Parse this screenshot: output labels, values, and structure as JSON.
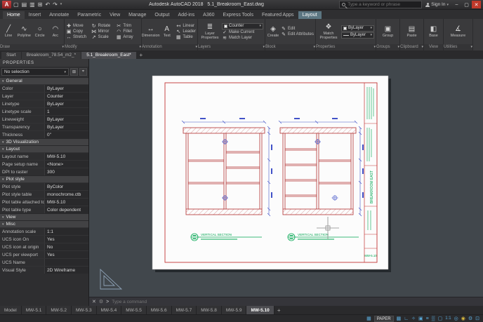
{
  "colors": {
    "accent_red": "#c23434",
    "dim_blue": "#4152c8",
    "anno_green": "#00a651",
    "status_blue": "#58a6d6"
  },
  "titlebar": {
    "logo": "A",
    "qat": {
      "new": "▢",
      "open": "▤",
      "save": "▥",
      "plot": "⊞",
      "undo": "↶",
      "redo": "↷",
      "dropdown": "▾"
    },
    "app_title": "Autodesk AutoCAD 2018",
    "doc_title": "5.1_Breakroom_East.dwg",
    "search_placeholder": "Type a keyword or phrase",
    "sign_in_label": "Sign In",
    "window": {
      "minimize": "–",
      "maximize": "▢",
      "close": "✕"
    }
  },
  "ribbon_tabs": [
    {
      "label": "Home",
      "active": true
    },
    {
      "label": "Insert"
    },
    {
      "label": "Annotate"
    },
    {
      "label": "Parametric"
    },
    {
      "label": "View"
    },
    {
      "label": "Manage"
    },
    {
      "label": "Output"
    },
    {
      "label": "Add-ins"
    },
    {
      "label": "A360"
    },
    {
      "label": "Express Tools"
    },
    {
      "label": "Featured Apps"
    },
    {
      "label": "Layout",
      "contextual": true
    }
  ],
  "ribbon": {
    "icons": {
      "caret": "▾",
      "line": "╱",
      "polyline": "∿",
      "circle": "○",
      "arc": "◠",
      "move": "✚",
      "copy": "▣",
      "stretch": "↔",
      "rotate": "↻",
      "mirror": "⋈",
      "scale": "↗",
      "trim": "✂",
      "fillet": "◠",
      "array": "▦",
      "dimension": "↔",
      "text": "A",
      "linear": "↤",
      "leader": "↖",
      "table": "▦",
      "layer_properties": "≣",
      "make_current": "✓",
      "match_layer": "≋",
      "create": "◈",
      "edit": "✎",
      "edit_attributes": "✎",
      "match_properties": "❖",
      "group": "▣",
      "paste": "▤",
      "base": "◧",
      "measure": "∡",
      "bylayer_line": "—"
    },
    "draw": {
      "label": "Draw",
      "line": "Line",
      "polyline": "Polyline",
      "circle": "Circle",
      "arc": "Arc"
    },
    "modify": {
      "label": "Modify",
      "move": "Move",
      "copy": "Copy",
      "stretch": "Stretch",
      "rotate": "Rotate",
      "mirror": "Mirror",
      "scale": "Scale",
      "trim": "Trim",
      "fillet": "Fillet",
      "array": "Array"
    },
    "annotation": {
      "label": "Annotation",
      "dimension": "Dimension",
      "text": "Text",
      "linear": "Linear",
      "leader": "Leader",
      "table": "Table"
    },
    "layers": {
      "label": "Layers",
      "layer_properties": "Layer Properties",
      "current_layer": "Counter",
      "make_current": "Make Current",
      "match_layer": "Match Layer"
    },
    "block": {
      "label": "Block",
      "create": "Create",
      "edit": "Edit",
      "edit_attributes": "Edit Attributes"
    },
    "properties": {
      "label": "Properties",
      "match_properties": "Match Properties",
      "bylayer_color": "ByLayer",
      "bylayer_lineweight": "ByLayer"
    },
    "groups": {
      "label": "Groups",
      "group": "Group"
    },
    "clipboard": {
      "label": "Clipboard",
      "paste": "Paste"
    },
    "view": {
      "label": "View",
      "base": "Base"
    },
    "utilities": {
      "label": "Utilities",
      "measure": "Measure"
    }
  },
  "file_tabs": [
    {
      "label": "Start"
    },
    {
      "label": "Breakroom_78.54_m2_*"
    },
    {
      "label": "5.1_Breakroom_East*",
      "active": true
    }
  ],
  "file_tab_add": "+",
  "palette": {
    "title": "PROPERTIES",
    "selector": "No selection",
    "chevron": "▾",
    "selector_buttons": {
      "toggle_pickadd": "⊞",
      "select_objects": "⌖"
    },
    "sections": {
      "general": {
        "title": "General",
        "rows": [
          {
            "label": "Color",
            "value": "ByLayer"
          },
          {
            "label": "Layer",
            "value": "Counter"
          },
          {
            "label": "Linetype",
            "value": "ByLayer"
          },
          {
            "label": "Linetype scale",
            "value": "1"
          },
          {
            "label": "Lineweight",
            "value": "ByLayer"
          },
          {
            "label": "Transparency",
            "value": "ByLayer"
          },
          {
            "label": "Thickness",
            "value": "0\""
          }
        ]
      },
      "vis3d": {
        "title": "3D Visualization",
        "rows": []
      },
      "layout": {
        "title": "Layout",
        "rows": [
          {
            "label": "Layout name",
            "value": "MW-5.10"
          },
          {
            "label": "Page setup name",
            "value": "<None>"
          },
          {
            "label": "DPI to raster",
            "value": "300"
          }
        ]
      },
      "plot_style": {
        "title": "Plot style",
        "rows": [
          {
            "label": "Plot style",
            "value": "ByColor"
          },
          {
            "label": "Plot style table",
            "value": "monochrome.ctb"
          },
          {
            "label": "Plot table attached to",
            "value": "MW-5.10"
          },
          {
            "label": "Plot table type",
            "value": "Color dependent"
          }
        ]
      },
      "view": {
        "title": "View",
        "rows": []
      },
      "misc": {
        "title": "Misc",
        "rows": [
          {
            "label": "Annotation scale",
            "value": "1:1"
          },
          {
            "label": "UCS icon On",
            "value": "Yes"
          },
          {
            "label": "UCS icon at origin",
            "value": "No"
          },
          {
            "label": "UCS per viewport",
            "value": "Yes"
          },
          {
            "label": "UCS Name",
            "value": ""
          },
          {
            "label": "Visual Style",
            "value": "2D Wireframe"
          }
        ]
      }
    }
  },
  "drawing": {
    "section_a_title": "VERTICAL SECTION",
    "section_b_title": "VERTICAL SECTION",
    "sheet_number": "MW-5.10",
    "title_block_heading": "BREAKROOM EAST"
  },
  "command_line": {
    "close": "✕",
    "customize": "⚙",
    "prompt": "&gt;",
    "placeholder": "Type a command"
  },
  "layout_tabs": [
    {
      "label": "Model"
    },
    {
      "label": "MW-5.1"
    },
    {
      "label": "MW-5.2"
    },
    {
      "label": "MW-5.3"
    },
    {
      "label": "MW-5.4"
    },
    {
      "label": "MW-5.5"
    },
    {
      "label": "MW-5.6"
    },
    {
      "label": "MW-5.7"
    },
    {
      "label": "MW-5.8"
    },
    {
      "label": "MW-5.9"
    },
    {
      "label": "MW-5.10",
      "active": true
    }
  ],
  "layout_tab_add": "+",
  "statusbar": {
    "paper": "PAPER",
    "icons": {
      "grid": "▦",
      "snap": "▩",
      "ortho": "∟",
      "polar": "✧",
      "osnap": "▣",
      "lineweight": "≡",
      "transparency": "▒",
      "selection_cycling": "▢",
      "annotation_scale": "1:1",
      "annotation_monitor": "◎",
      "isolate": "◉",
      "workspace_gear": "⚙",
      "clean_screen": "⊡"
    }
  }
}
